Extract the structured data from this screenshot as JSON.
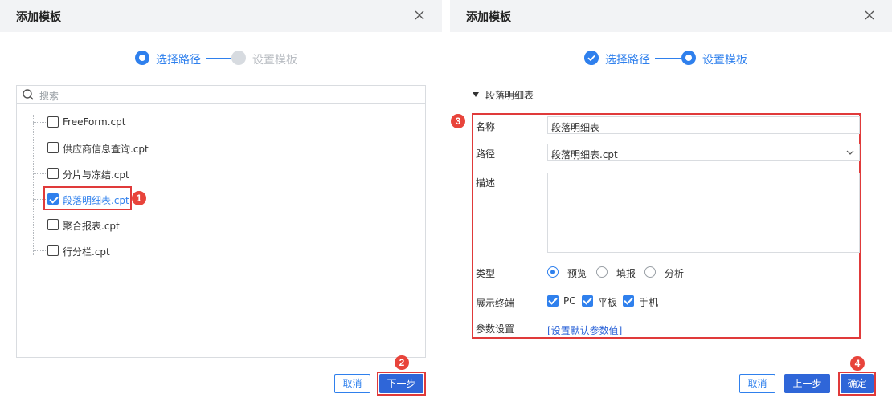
{
  "colors": {
    "accent": "#2f80ed",
    "highlight": "#e03a3a",
    "badge": "#e8443b",
    "header_bg": "#f2f3f5"
  },
  "left": {
    "title": "添加模板",
    "close_icon": "close-icon",
    "steps": [
      {
        "label": "选择路径",
        "state": "active"
      },
      {
        "label": "设置模板",
        "state": "disabled"
      }
    ],
    "search": {
      "placeholder": "搜索",
      "icon": "search-icon"
    },
    "tree": [
      {
        "label": "FreeForm.cpt",
        "checked": false
      },
      {
        "label": "供应商信息查询.cpt",
        "checked": false
      },
      {
        "label": "分片与冻结.cpt",
        "checked": false
      },
      {
        "label": "段落明细表.cpt",
        "checked": true
      },
      {
        "label": "聚合报表.cpt",
        "checked": false
      },
      {
        "label": "行分栏.cpt",
        "checked": false
      }
    ],
    "badges": {
      "tree": "1",
      "next": "2"
    },
    "buttons": {
      "cancel": "取消",
      "next": "下一步"
    }
  },
  "right": {
    "title": "添加模板",
    "close_icon": "close-icon",
    "steps": [
      {
        "label": "选择路径",
        "state": "done"
      },
      {
        "label": "设置模板",
        "state": "active"
      }
    ],
    "section": "段落明细表",
    "form": {
      "name_label": "名称",
      "name_value": "段落明细表",
      "path_label": "路径",
      "path_value": "段落明细表.cpt",
      "desc_label": "描述",
      "desc_value": "",
      "type_label": "类型",
      "type_options": [
        "预览",
        "填报",
        "分析"
      ],
      "type_selected": "预览",
      "terminal_label": "展示终端",
      "terminal_options": [
        "PC",
        "平板",
        "手机"
      ],
      "param_label": "参数设置",
      "param_link": "[设置默认参数值]"
    },
    "badges": {
      "form": "3",
      "confirm": "4"
    },
    "buttons": {
      "cancel": "取消",
      "prev": "上一步",
      "confirm": "确定"
    }
  }
}
